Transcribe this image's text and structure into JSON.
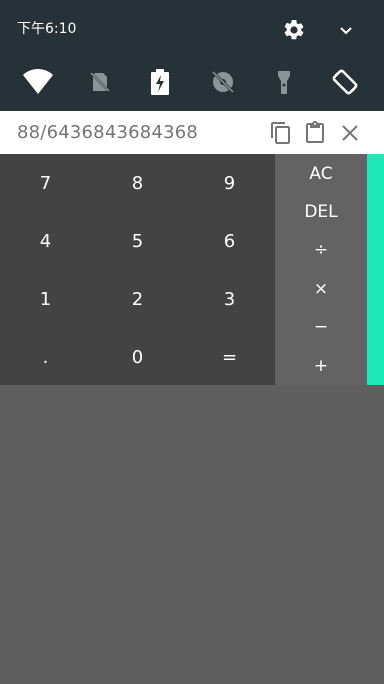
{
  "status": {
    "time": "下午6:10"
  },
  "quick_settings": {
    "tiles": [
      {
        "icon": "wifi-icon"
      },
      {
        "icon": "no-sim-icon"
      },
      {
        "icon": "battery-saver-icon"
      },
      {
        "icon": "location-off-icon"
      },
      {
        "icon": "flashlight-icon"
      },
      {
        "icon": "auto-rotate-icon"
      }
    ]
  },
  "expression": {
    "value": "88/6436843684368",
    "copy_icon": "copy-icon",
    "paste_icon": "paste-icon",
    "close_icon": "close-icon"
  },
  "keypad": {
    "row1": [
      "7",
      "8",
      "9"
    ],
    "row2": [
      "4",
      "5",
      "6"
    ],
    "row3": [
      "1",
      "2",
      "3"
    ],
    "row4": [
      ".",
      "0",
      "="
    ]
  },
  "operators": [
    "AC",
    "DEL",
    "÷",
    "×",
    "−",
    "+"
  ],
  "colors": {
    "shade": "#263238",
    "numpad": "#434343",
    "operators": "#636363",
    "accent": "#1de9b6",
    "background": "#5f5f5f"
  }
}
